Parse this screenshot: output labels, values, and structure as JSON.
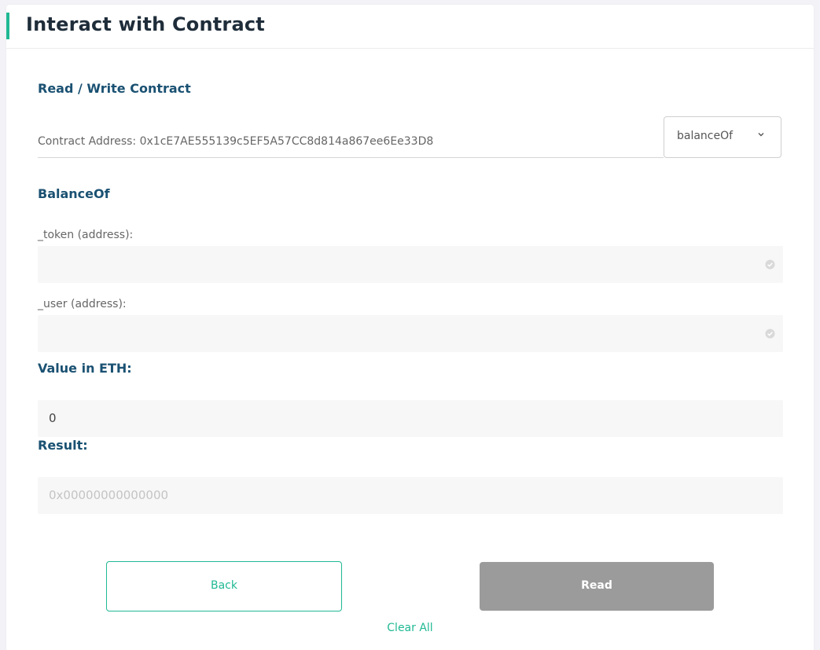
{
  "header": {
    "title": "Interact with Contract"
  },
  "section": {
    "title": "Read / Write Contract"
  },
  "contract": {
    "address_label": "Contract Address: 0x1cE7AE555139c5EF5A57CC8d814a867ee6Ee33D8"
  },
  "method_select": {
    "selected": "balanceOf",
    "icon": "chevron-down-icon"
  },
  "method": {
    "title": "BalanceOf"
  },
  "fields": [
    {
      "label": "_token (address):",
      "value": "",
      "icon": "check-circle-icon"
    },
    {
      "label": "_user (address):",
      "value": "",
      "icon": "check-circle-icon"
    }
  ],
  "value_eth": {
    "label": "Value in ETH:",
    "value": "0"
  },
  "result": {
    "label": "Result:",
    "placeholder": "0x00000000000000"
  },
  "buttons": {
    "back": "Back",
    "read": "Read",
    "clear_all": "Clear All"
  },
  "colors": {
    "accent": "#21b994",
    "title": "#1a5172",
    "disabled": "#9b9b9b"
  }
}
